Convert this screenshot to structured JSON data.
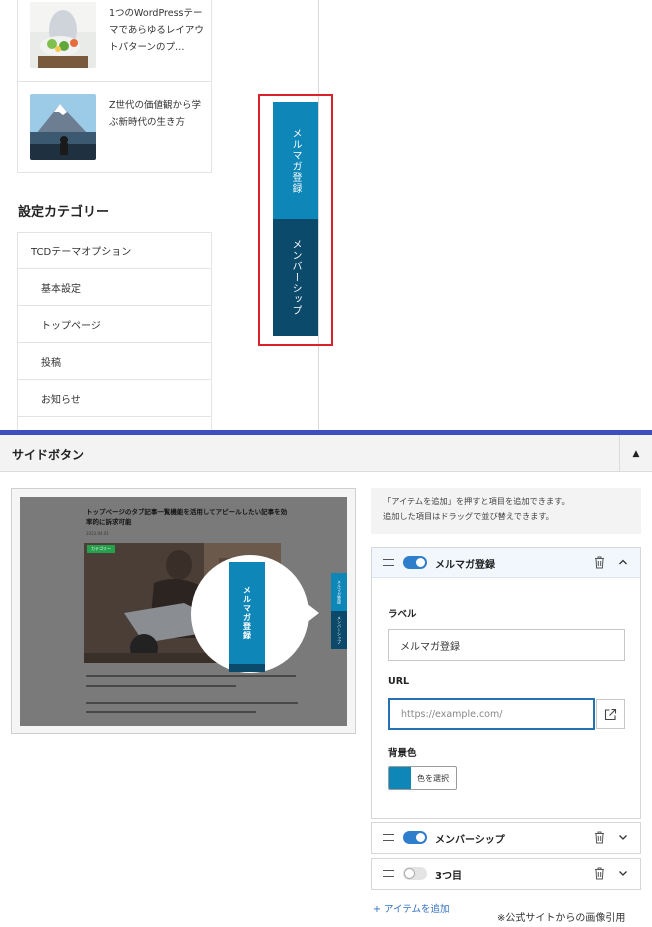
{
  "top": {
    "posts": [
      {
        "title": "1つのWordPressテーマであらゆるレイアウトパターンのプ…"
      },
      {
        "title": "Z世代の価値観から学ぶ新時代の生き方"
      }
    ],
    "category_heading": "設定カテゴリー",
    "categories": [
      "TCDテーマオプション",
      "基本設定",
      "トップページ",
      "投稿",
      "お知らせ"
    ],
    "side_buttons": [
      {
        "label": "メルマガ登録",
        "color": "#0e86b8"
      },
      {
        "label": "メンバーシップ",
        "color": "#0b4a6b"
      }
    ],
    "highlight_color": "#d8232a"
  },
  "panel": {
    "title": "サイドボタン",
    "toggle_icon": "triangle-up-icon"
  },
  "preview": {
    "title": "トップページのタブ記事一覧機能を活用してアピールしたい記事を効率的に訴求可能",
    "date": "2023.04.01",
    "badge": "カテゴリー",
    "bubble_label": "メルマガ登録",
    "tab1_label": "メルマガ登録",
    "tab2_label": "メンバーシップ"
  },
  "info": {
    "line1": "「アイテムを追加」を押すと項目を追加できます。",
    "line2": "追加した項目はドラッグで並び替えできます。"
  },
  "items": [
    {
      "label": "メルマガ登録",
      "enabled": true,
      "expanded": true,
      "fields": {
        "label_title": "ラベル",
        "label_value": "メルマガ登録",
        "url_title": "URL",
        "url_placeholder": "https://example.com/",
        "bg_title": "背景色",
        "color_button": "色を選択",
        "color_value": "#0e86b8"
      }
    },
    {
      "label": "メンバーシップ",
      "enabled": true,
      "expanded": false
    },
    {
      "label": "3つ目",
      "enabled": false,
      "expanded": false
    }
  ],
  "add_item": "+ アイテムを追加",
  "source_note": "※公式サイトからの画像引用"
}
